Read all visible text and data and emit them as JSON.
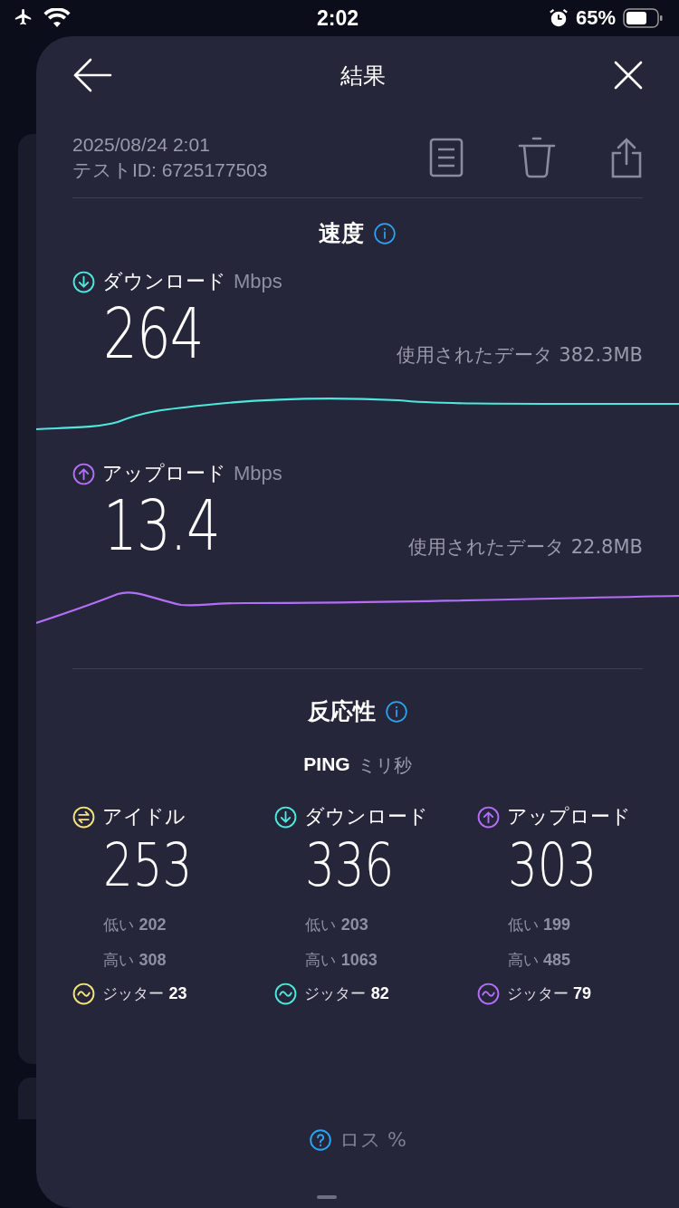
{
  "status_bar": {
    "time": "2:02",
    "battery": "65%"
  },
  "header": {
    "title": "結果"
  },
  "test_info": {
    "date": "2025/08/24 2:01",
    "test_id": "テストID: 6725177503"
  },
  "speed": {
    "title": "速度",
    "items": [
      {
        "kind": "download",
        "label": "ダウンロード",
        "unit": "Mbps",
        "value": "264",
        "data_used": "使用されたデータ 382.3MB",
        "color": "#4de8dc"
      },
      {
        "kind": "upload",
        "label": "アップロード",
        "unit": "Mbps",
        "value": "13.4",
        "data_used": "使用されたデータ 22.8MB",
        "color": "#b26ef5"
      }
    ]
  },
  "responsiveness": {
    "title": "反応性",
    "ping_label": "PING",
    "ping_unit": "ミリ秒",
    "columns": [
      {
        "kind": "idle",
        "label": "アイドル",
        "value": "253",
        "low_label": "低い",
        "low": "202",
        "high_label": "高い",
        "high": "308",
        "jitter_label": "ジッター",
        "jitter": "23",
        "color": "#f5e47a"
      },
      {
        "kind": "download",
        "label": "ダウンロード",
        "value": "336",
        "low_label": "低い",
        "low": "203",
        "high_label": "高い",
        "high": "1063",
        "jitter_label": "ジッター",
        "jitter": "82",
        "color": "#4de8dc"
      },
      {
        "kind": "upload",
        "label": "アップロード",
        "value": "303",
        "low_label": "低い",
        "low": "199",
        "high_label": "高い",
        "high": "485",
        "jitter_label": "ジッター",
        "jitter": "79",
        "color": "#b26ef5"
      }
    ]
  },
  "loss": {
    "label": "ロス",
    "unit": "%"
  }
}
